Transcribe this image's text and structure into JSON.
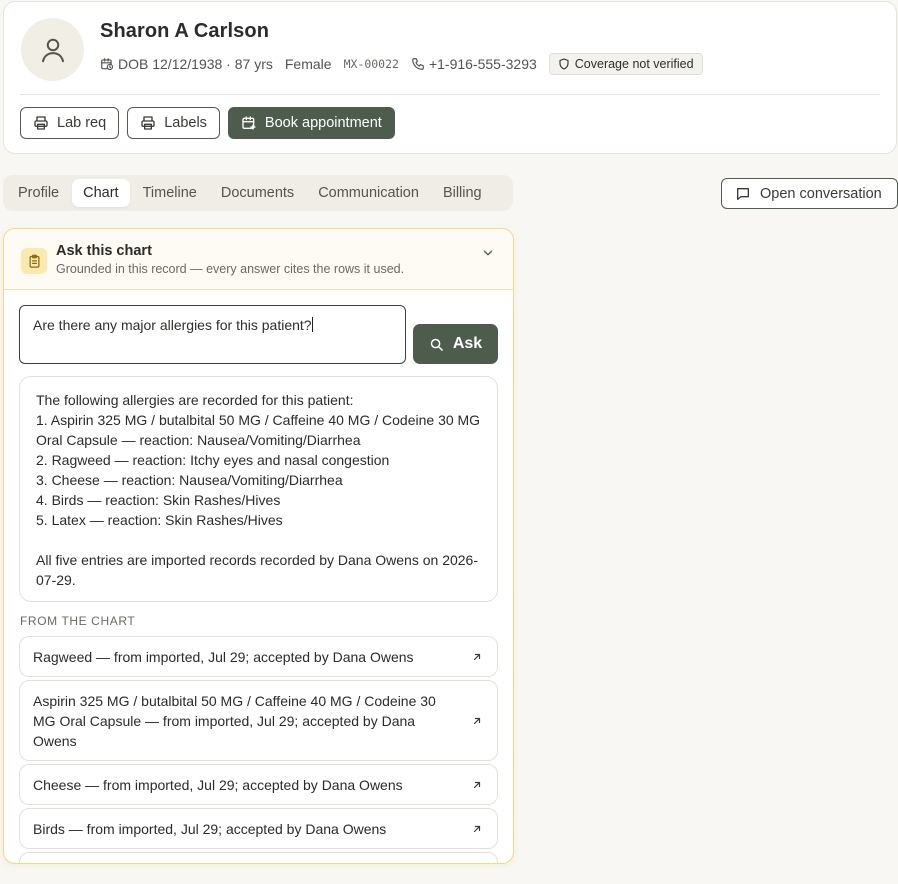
{
  "patient": {
    "name": "Sharon A Carlson",
    "dob": "DOB 12/12/1938 · 87 yrs",
    "sex": "Female",
    "mrn": "MX-00022",
    "phone": "+1-916-555-3293",
    "coverage": "Coverage not verified"
  },
  "actions": {
    "lab_req": "Lab req",
    "labels": "Labels",
    "book": "Book appointment"
  },
  "tabs": [
    {
      "label": "Profile"
    },
    {
      "label": "Chart"
    },
    {
      "label": "Timeline"
    },
    {
      "label": "Documents"
    },
    {
      "label": "Communication"
    },
    {
      "label": "Billing"
    }
  ],
  "open_conversation": "Open conversation",
  "ask": {
    "title": "Ask this chart",
    "subtitle": "Grounded in this record — every answer cites the rows it used.",
    "question": "Are there any major allergies for this patient?",
    "button": "Ask",
    "answer": "The following allergies are recorded for this patient:\n1. Aspirin 325 MG / butalbital 50 MG / Caffeine 40 MG / Codeine 30 MG Oral Capsule — reaction: Nausea/Vomiting/Diarrhea\n2. Ragweed — reaction: Itchy eyes and nasal congestion\n3. Cheese — reaction: Nausea/Vomiting/Diarrhea\n4. Birds — reaction: Skin Rashes/Hives\n5. Latex — reaction: Skin Rashes/Hives\n\nAll five entries are imported records recorded by Dana Owens on 2026-07-29.",
    "from_label": "FROM THE CHART",
    "citations": [
      "Ragweed — from imported, Jul 29; accepted by Dana Owens",
      "Aspirin 325 MG / butalbital 50 MG / Caffeine 40 MG / Codeine 30 MG Oral Capsule — from imported, Jul 29; accepted by Dana Owens",
      "Cheese — from imported, Jul 29; accepted by Dana Owens",
      "Birds — from imported, Jul 29; accepted by Dana Owens",
      ""
    ]
  }
}
